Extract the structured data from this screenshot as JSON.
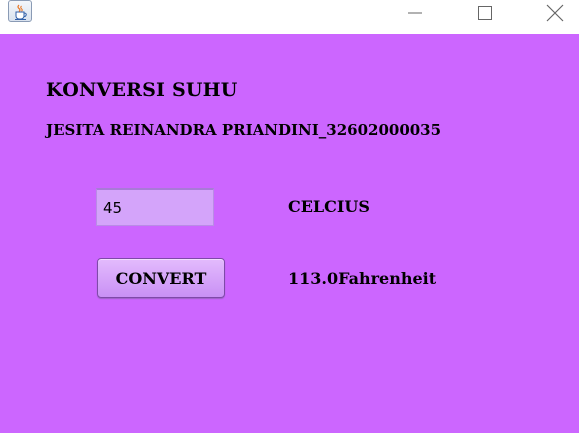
{
  "window": {
    "icon": "java-cup-icon",
    "controls": {
      "minimize_icon": "minimize-icon",
      "maximize_icon": "maximize-icon",
      "close_icon": "close-icon"
    }
  },
  "form": {
    "title": "KONVERSI SUHU",
    "subtitle": "JESITA REINANDRA PRIANDINI_32602000035",
    "input_value": "45",
    "unit_label": "CELCIUS",
    "convert_label": "CONVERT",
    "result_text": "113.0Fahrenheit"
  },
  "colors": {
    "background": "#cc66ff",
    "input_background": "#d4a4fa",
    "button_background": "#d8a8fb"
  }
}
